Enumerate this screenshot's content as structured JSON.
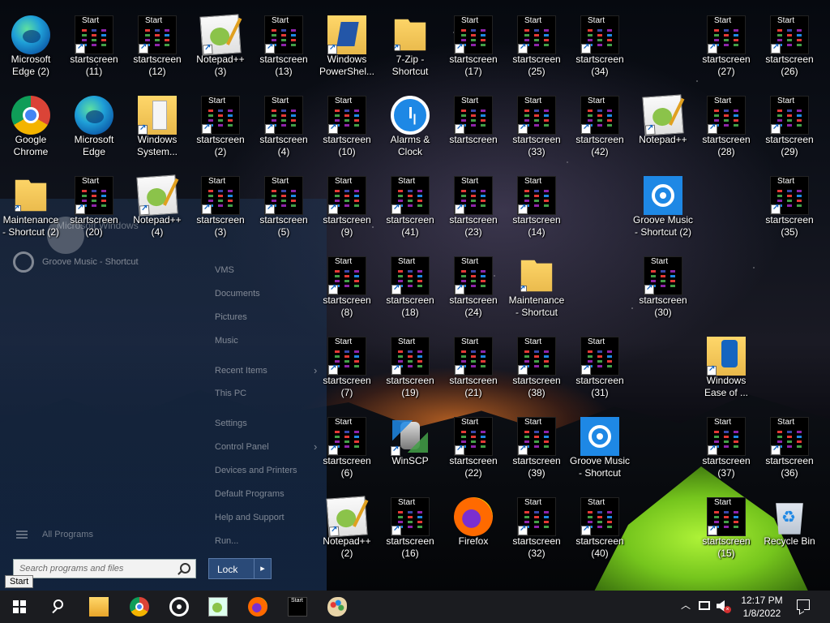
{
  "taskbar": {
    "start_tooltip": "Start",
    "thumb_caption": "Start",
    "clock_time": "12:17 PM",
    "clock_date": "1/8/2022"
  },
  "start_menu": {
    "recent_item": "Groove Music - Shortcut",
    "right_items": [
      "VMS",
      "Documents",
      "Pictures",
      "Music",
      "Recent Items",
      "This PC",
      "Settings",
      "Control Panel",
      "Devices and Printers",
      "Default Programs",
      "Help and Support",
      "Run..."
    ],
    "all_programs": "All Programs",
    "search_placeholder": "Search programs and files",
    "lock_label": "Lock",
    "overlay_text": "Microsoft Windows"
  },
  "desktop": {
    "thumb_caption": "Start",
    "icons": [
      {
        "name": "Microsoft Edge (2)",
        "type": "edge-icon"
      },
      {
        "name": "startscreen (11)",
        "type": "startscreen-icon"
      },
      {
        "name": "startscreen (12)",
        "type": "startscreen-icon"
      },
      {
        "name": "Notepad++ (3)",
        "type": "notepadpp-icon"
      },
      {
        "name": "startscreen (13)",
        "type": "startscreen-icon"
      },
      {
        "name": "Windows PowerShel...",
        "type": "powershell-folder-icon"
      },
      {
        "name": "7-Zip - Shortcut",
        "type": "folder-icon"
      },
      {
        "name": "startscreen (17)",
        "type": "startscreen-icon"
      },
      {
        "name": "startscreen (25)",
        "type": "startscreen-icon"
      },
      {
        "name": "startscreen (34)",
        "type": "startscreen-icon"
      },
      {
        "name": "startscreen (27)",
        "type": "startscreen-icon"
      },
      {
        "name": "startscreen (26)",
        "type": "startscreen-icon"
      },
      {
        "name": "Google Chrome",
        "type": "chrome-icon"
      },
      {
        "name": "Microsoft Edge",
        "type": "edge-icon"
      },
      {
        "name": "Windows System...",
        "type": "system-folder-icon"
      },
      {
        "name": "startscreen (2)",
        "type": "startscreen-icon"
      },
      {
        "name": "startscreen (4)",
        "type": "startscreen-icon"
      },
      {
        "name": "startscreen (10)",
        "type": "startscreen-icon"
      },
      {
        "name": "Alarms & Clock",
        "type": "alarm-clock-icon"
      },
      {
        "name": "startscreen",
        "type": "startscreen-icon"
      },
      {
        "name": "startscreen (33)",
        "type": "startscreen-icon"
      },
      {
        "name": "startscreen (42)",
        "type": "startscreen-icon"
      },
      {
        "name": "Notepad++",
        "type": "notepadpp-icon"
      },
      {
        "name": "startscreen (28)",
        "type": "startscreen-icon"
      },
      {
        "name": "startscreen (29)",
        "type": "startscreen-icon"
      },
      {
        "name": "Maintenance - Shortcut (2)",
        "type": "folder-icon"
      },
      {
        "name": "startscreen (20)",
        "type": "startscreen-icon"
      },
      {
        "name": "Notepad++ (4)",
        "type": "notepadpp-icon"
      },
      {
        "name": "startscreen (3)",
        "type": "startscreen-icon"
      },
      {
        "name": "startscreen (5)",
        "type": "startscreen-icon"
      },
      {
        "name": "startscreen (9)",
        "type": "startscreen-icon"
      },
      {
        "name": "startscreen (41)",
        "type": "startscreen-icon"
      },
      {
        "name": "startscreen (23)",
        "type": "startscreen-icon"
      },
      {
        "name": "startscreen (14)",
        "type": "startscreen-icon"
      },
      {
        "name": "Groove Music - Shortcut (2)",
        "type": "groove-music-icon"
      },
      {
        "name": "startscreen (35)",
        "type": "startscreen-icon"
      },
      {
        "name": "startscreen (8)",
        "type": "startscreen-icon"
      },
      {
        "name": "startscreen (18)",
        "type": "startscreen-icon"
      },
      {
        "name": "startscreen (24)",
        "type": "startscreen-icon"
      },
      {
        "name": "Maintenance - Shortcut",
        "type": "folder-icon"
      },
      {
        "name": "startscreen (30)",
        "type": "startscreen-icon"
      },
      {
        "name": "startscreen (7)",
        "type": "startscreen-icon"
      },
      {
        "name": "startscreen (19)",
        "type": "startscreen-icon"
      },
      {
        "name": "startscreen (21)",
        "type": "startscreen-icon"
      },
      {
        "name": "startscreen (38)",
        "type": "startscreen-icon"
      },
      {
        "name": "startscreen (31)",
        "type": "startscreen-icon"
      },
      {
        "name": "Windows Ease of ...",
        "type": "ease-folder-icon"
      },
      {
        "name": "startscreen (6)",
        "type": "startscreen-icon"
      },
      {
        "name": "WinSCP",
        "type": "winscp-icon"
      },
      {
        "name": "startscreen (22)",
        "type": "startscreen-icon"
      },
      {
        "name": "startscreen (39)",
        "type": "startscreen-icon"
      },
      {
        "name": "Groove Music - Shortcut",
        "type": "groove-music-icon"
      },
      {
        "name": "startscreen (37)",
        "type": "startscreen-icon"
      },
      {
        "name": "startscreen (36)",
        "type": "startscreen-icon"
      },
      {
        "name": "Notepad++ (2)",
        "type": "notepadpp-icon"
      },
      {
        "name": "startscreen (16)",
        "type": "startscreen-icon"
      },
      {
        "name": "Firefox",
        "type": "firefox-icon"
      },
      {
        "name": "startscreen (32)",
        "type": "startscreen-icon"
      },
      {
        "name": "startscreen (40)",
        "type": "startscreen-icon"
      },
      {
        "name": "startscreen (15)",
        "type": "startscreen-icon"
      },
      {
        "name": "Recycle Bin",
        "type": "recycle-bin-icon"
      }
    ]
  }
}
